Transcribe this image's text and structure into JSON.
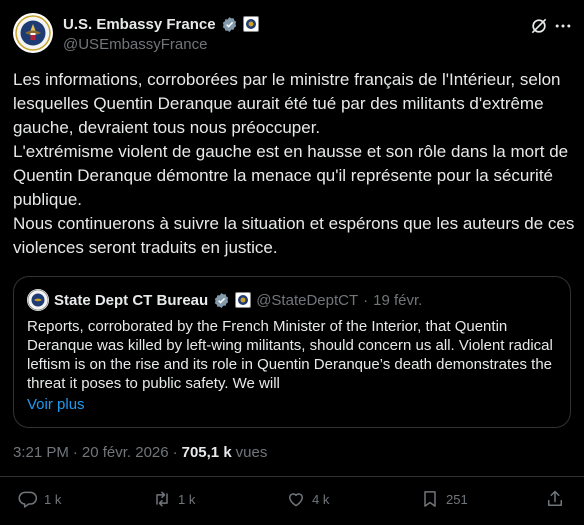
{
  "author": {
    "name": "U.S. Embassy France",
    "handle": "@USEmbassyFrance"
  },
  "post": {
    "paragraphs": [
      "Les informations, corroborées par le ministre français de l'Intérieur, selon lesquelles Quentin Deranque aurait été tué par des militants d'extrême gauche, devraient tous nous préoccuper.",
      "L'extrémisme violent de gauche est en hausse et son rôle dans la mort de Quentin Deranque démontre la menace qu'il représente pour la sécurité publique.",
      "Nous continuerons à suivre la situation et espérons que les auteurs de ces violences seront traduits en justice."
    ],
    "time": "3:21 PM",
    "separator": "·",
    "date": "20 févr. 2026",
    "views_count": "705,1 k",
    "views_label": "vues"
  },
  "quote": {
    "name": "State Dept CT Bureau",
    "handle": "@StateDeptCT",
    "dot": "·",
    "date": "19 févr.",
    "text": "Reports, corroborated by the French Minister of the Interior, that Quentin Deranque was killed by left-wing militants, should concern us all. Violent radical leftism is on the rise and its role in Quentin Deranque’s death demonstrates the threat it poses to public safety. We will",
    "read_more": "Voir plus"
  },
  "actions": {
    "replies": "1 k",
    "reposts": "1 k",
    "likes": "4 k",
    "bookmarks": "251"
  },
  "colors": {
    "background": "#000000",
    "text": "#e7e9ea",
    "muted": "#71767b",
    "link": "#1d9bf0",
    "verified": "#829aab",
    "border": "#2f3336"
  },
  "icons": [
    "seal-avatar",
    "verified-badge-icon",
    "affiliate-seal-icon",
    "grok-icon",
    "more-icon",
    "reply-icon",
    "repost-icon",
    "like-icon",
    "bookmark-icon",
    "share-icon"
  ]
}
